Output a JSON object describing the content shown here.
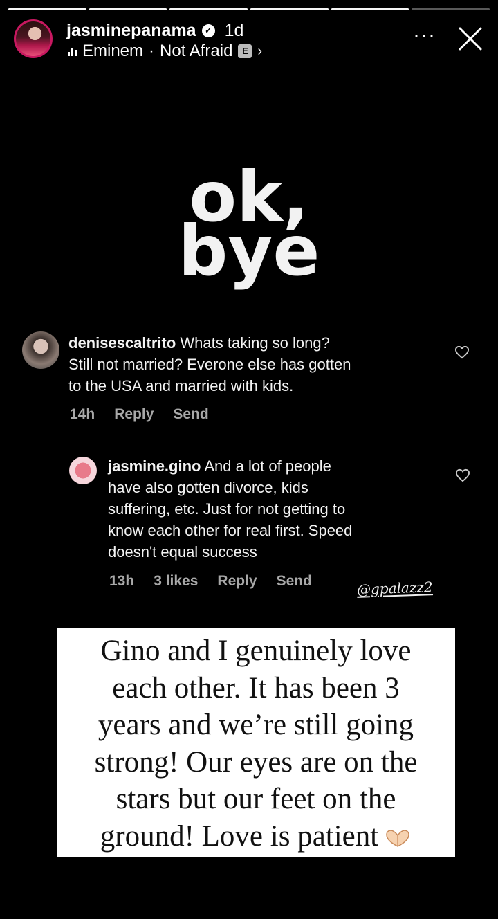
{
  "story": {
    "progress_fractions": [
      1,
      1,
      1,
      1,
      1,
      0.0
    ]
  },
  "header": {
    "username": "jasminepanama",
    "time": "1d",
    "music_artist": "Eminem",
    "music_separator": "·",
    "music_title": "Not Afraid",
    "explicit_badge": "E",
    "more_label": "···"
  },
  "big_text": {
    "line1": "ok,",
    "line2": "bye"
  },
  "comment1": {
    "username": "denisescaltrito",
    "text_line1": " Whats taking so long?",
    "text_line2": "Still not married? Everone else has gotten",
    "text_line3": "to the USA and married with kids.",
    "time": "14h",
    "reply": "Reply",
    "send": "Send"
  },
  "comment2": {
    "username": "jasmine.gino",
    "text_line1": " And a lot of people",
    "text_line2": "have also gotten divorce, kids",
    "text_line3": "suffering, etc. Just for not getting to",
    "text_line4": "know each other for real first. Speed",
    "text_line5": "doesn't equal success",
    "time": "13h",
    "likes": "3 likes",
    "reply": "Reply",
    "send": "Send"
  },
  "watermark": "@gpalazz2",
  "statement": {
    "line1": "Gino and I genuinely love",
    "line2": "each other. It has been 3",
    "line3": "years and we’re still going",
    "line4": "strong! Our eyes are on the",
    "line5": "stars but our feet on the",
    "line6": "ground! Love is patient"
  },
  "colors": {
    "avatar_ring": "#c81860",
    "meta_text": "#a8a8a8"
  }
}
